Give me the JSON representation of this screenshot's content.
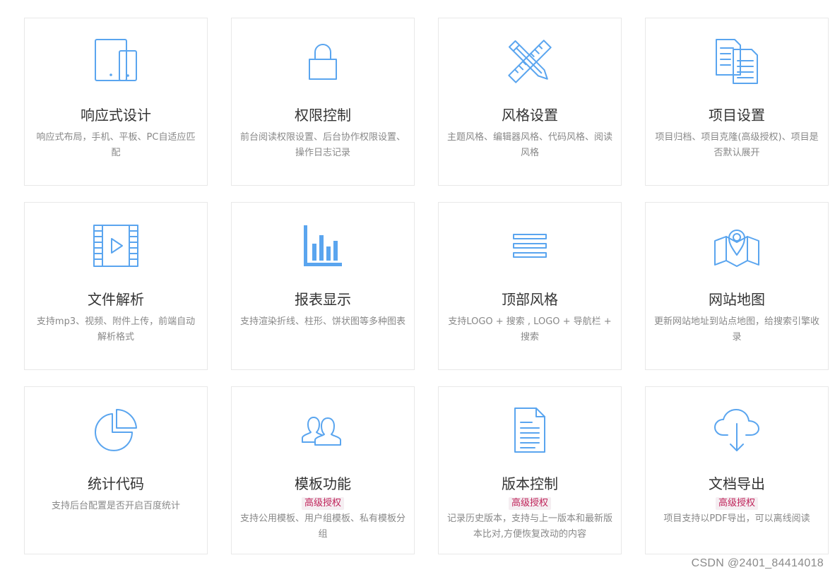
{
  "features": [
    {
      "icon": "responsive-devices-icon",
      "title": "响应式设计",
      "badge": "",
      "desc": "响应式布局，手机、平板、PC自适应匹配"
    },
    {
      "icon": "lock-icon",
      "title": "权限控制",
      "badge": "",
      "desc": "前台阅读权限设置、后台协作权限设置、操作日志记录"
    },
    {
      "icon": "pencil-ruler-icon",
      "title": "风格设置",
      "badge": "",
      "desc": "主题风格、编辑器风格、代码风格、阅读风格"
    },
    {
      "icon": "documents-icon",
      "title": "项目设置",
      "badge": "",
      "desc": "项目归档、项目克隆(高级授权)、项目是否默认展开"
    },
    {
      "icon": "video-file-icon",
      "title": "文件解析",
      "badge": "",
      "desc": "支持mp3、视频、附件上传，前端自动解析格式"
    },
    {
      "icon": "bar-chart-icon",
      "title": "报表显示",
      "badge": "",
      "desc": "支持渲染折线、柱形、饼状图等多种图表"
    },
    {
      "icon": "menu-lines-icon",
      "title": "顶部风格",
      "badge": "",
      "desc": "支持LOGO + 搜索 , LOGO + 导航栏 + 搜索"
    },
    {
      "icon": "map-pin-icon",
      "title": "网站地图",
      "badge": "",
      "desc": "更新网站地址到站点地图，给搜索引擎收录"
    },
    {
      "icon": "pie-chart-icon",
      "title": "统计代码",
      "badge": "",
      "desc": "支持后台配置是否开启百度统计"
    },
    {
      "icon": "users-icon",
      "title": "模板功能",
      "badge": "高级授权",
      "desc": "支持公用模板、用户组模板、私有模板分组"
    },
    {
      "icon": "document-lines-icon",
      "title": "版本控制",
      "badge": "高级授权",
      "desc": "记录历史版本，支持与上一版本和最新版本比对,方便恢复改动的内容"
    },
    {
      "icon": "cloud-download-icon",
      "title": "文档导出",
      "badge": "高级授权",
      "desc": "项目支持以PDF导出，可以离线阅读"
    }
  ],
  "watermark": "CSDN @2401_84414018",
  "colors": {
    "accent": "#5aa5ef",
    "title": "#333333",
    "desc": "#888888",
    "badge_text": "#c0245a",
    "badge_bg": "#f5eef2"
  }
}
